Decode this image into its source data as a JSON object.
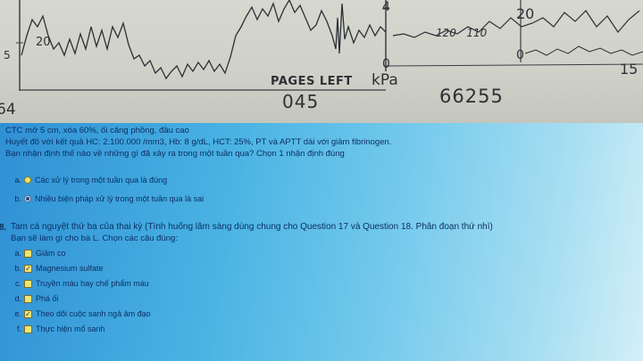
{
  "monitor": {
    "scale_label_top_left": "20",
    "scale_label_left_mid": "5",
    "uc_label_top": "4",
    "uc_label_zero": "0",
    "right_label_20": "20",
    "right_label_0": "0",
    "right_label_15": "15",
    "left_corner_label": "64",
    "readout_badges": "120   110",
    "pages_left_label": "PAGES LEFT",
    "pages_left_value": "045",
    "unit_label": "kPa",
    "counter_value": "66255"
  },
  "question17": {
    "case_line1": "CTC mở 5 cm, xóa 60%, ối căng phồng, đầu cao",
    "case_line2": "Huyết đồ với kết quả HC: 2.100.000 /mm3, Hb: 8 g/dL, HCT: 25%, PT và APTT dài với giảm fibrinogen.",
    "prompt": "Bạn nhận định thế nào về những gì đã xảy ra trong một tuần qua? Chọn 1 nhận định đúng",
    "options": [
      {
        "letter": "a.",
        "text": "Các xử lý trong một tuần qua là đúng",
        "checked": false
      },
      {
        "letter": "b.",
        "text": "Nhiều biện pháp xử lý trong một tuần qua là sai",
        "checked": true
      }
    ]
  },
  "question18": {
    "number": "8.",
    "title": "Tam cá nguyệt thứ ba của thai kỳ (Tình huống lâm sàng dùng chung cho Question 17 và Question 18. Phân đoạn thứ nhì)",
    "prompt": "Bạn sẽ làm gì cho bà L. Chọn các câu đúng:",
    "options": [
      {
        "letter": "a.",
        "text": "Giảm co",
        "checked": false
      },
      {
        "letter": "b.",
        "text": "Magnesium sulfate",
        "checked": true
      },
      {
        "letter": "c.",
        "text": "Truyền máu hay chế phẩm máu",
        "checked": false
      },
      {
        "letter": "d.",
        "text": "Phá ối",
        "checked": false
      },
      {
        "letter": "e.",
        "text": "Theo dõi cuộc sanh ngả âm đạo",
        "checked": true
      },
      {
        "letter": "f.",
        "text": "Thực hiện mổ sanh",
        "checked": false
      }
    ],
    "check_glyph": "✓"
  }
}
